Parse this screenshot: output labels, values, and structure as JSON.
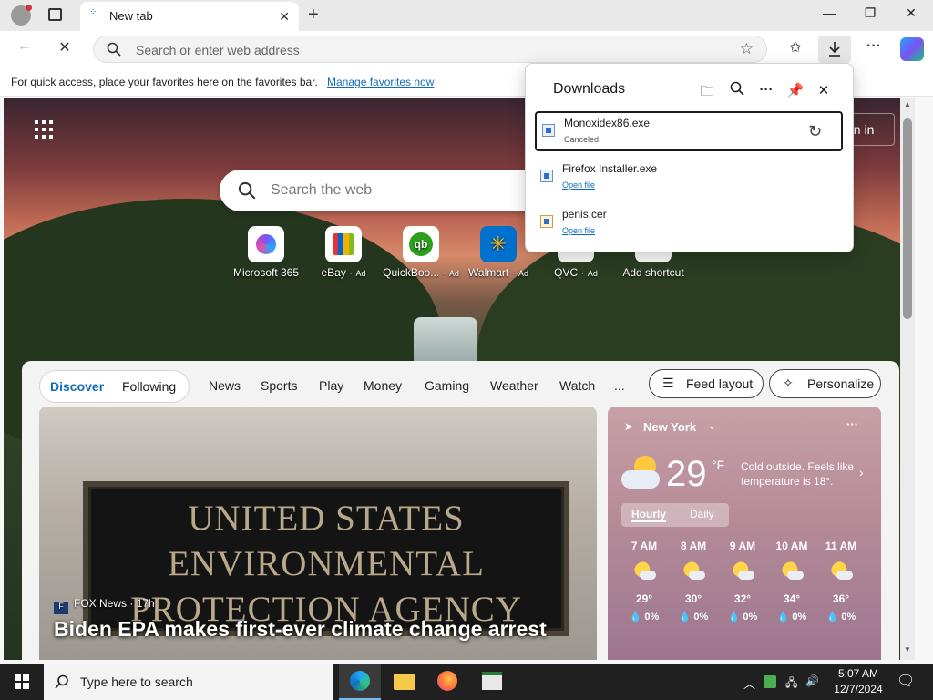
{
  "browser": {
    "tab": {
      "title": "New tab"
    },
    "address_bar": {
      "placeholder": "Search or enter web address"
    },
    "favorites_bar": {
      "message": "For quick access, place your favorites here on the favorites bar.",
      "link": "Manage favorites now"
    }
  },
  "new_tab": {
    "sign_in": "gn in",
    "search_placeholder": "Search the web",
    "tiles": [
      {
        "label": "Microsoft 365",
        "ad": ""
      },
      {
        "label": "eBay",
        "ad": "Ad"
      },
      {
        "label": "QuickBoo...",
        "ad": "Ad"
      },
      {
        "label": "Walmart",
        "ad": "Ad"
      },
      {
        "label": "QVC",
        "ad": "Ad"
      },
      {
        "label": "Add shortcut",
        "ad": ""
      }
    ],
    "feed": {
      "tabs": {
        "discover": "Discover",
        "following": "Following"
      },
      "nav": [
        "News",
        "Sports",
        "Play",
        "Money",
        "Gaming",
        "Weather",
        "Watch",
        "..."
      ],
      "feed_layout": "Feed layout",
      "personalize": "Personalize",
      "main_story": {
        "image_text": [
          "UNITED STATES",
          "ENVIRONMENTAL",
          "PROTECTION AGENCY"
        ],
        "source": "FOX News",
        "age": "· 17h",
        "headline": "Biden EPA makes first-ever climate change arrest"
      },
      "weather": {
        "location": "New York",
        "temp": "29",
        "unit": "°F",
        "description": "Cold outside. Feels like temperature is 18°.",
        "tabs": {
          "hourly": "Hourly",
          "daily": "Daily"
        },
        "hours": [
          {
            "time": "7 AM",
            "temp": "29°",
            "precip": "0%"
          },
          {
            "time": "8 AM",
            "temp": "30°",
            "precip": "0%"
          },
          {
            "time": "9 AM",
            "temp": "32°",
            "precip": "0%"
          },
          {
            "time": "10 AM",
            "temp": "34°",
            "precip": "0%"
          },
          {
            "time": "11 AM",
            "temp": "36°",
            "precip": "0%"
          }
        ]
      }
    }
  },
  "downloads": {
    "title": "Downloads",
    "items": [
      {
        "name": "Monoxidex86.exe",
        "status": "Canceled",
        "link": ""
      },
      {
        "name": "Firefox Installer.exe",
        "status": "",
        "link": "Open file"
      },
      {
        "name": "penis.cer",
        "status": "",
        "link": "Open file"
      }
    ]
  },
  "taskbar": {
    "search_placeholder": "Type here to search",
    "time": "5:07 AM",
    "date": "12/7/2024"
  }
}
